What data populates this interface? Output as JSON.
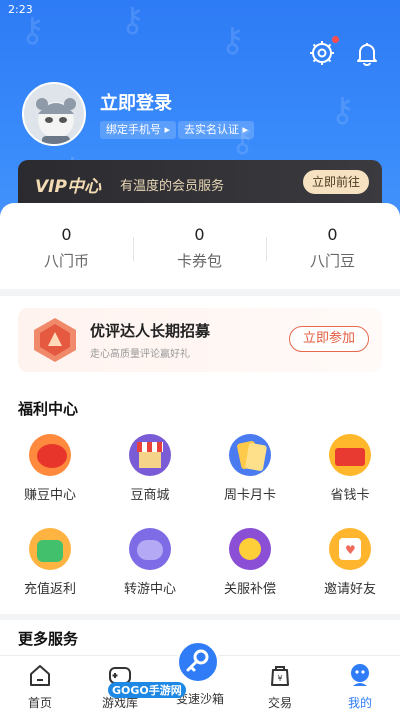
{
  "status_bar": {
    "time": "2:23"
  },
  "header": {
    "login_title": "立即登录",
    "bind_phone": "绑定手机号 ▸",
    "verify": "去实名认证 ▸"
  },
  "vip": {
    "logo": "VIP中心",
    "subtitle": "有温度的会员服务",
    "button": "立即前往"
  },
  "stats": [
    {
      "value": "0",
      "label": "八门币"
    },
    {
      "value": "0",
      "label": "卡券包"
    },
    {
      "value": "0",
      "label": "八门豆"
    }
  ],
  "recruit": {
    "title": "优评达人长期招募",
    "subtitle": "走心高质量评论赢好礼",
    "button": "立即参加"
  },
  "welfare": {
    "title": "福利中心",
    "items": [
      {
        "label": "赚豆中心",
        "icon": "earn-beans-icon"
      },
      {
        "label": "豆商城",
        "icon": "bean-mall-icon"
      },
      {
        "label": "周卡月卡",
        "icon": "week-month-card-icon"
      },
      {
        "label": "省钱卡",
        "icon": "save-money-card-icon"
      },
      {
        "label": "充值返利",
        "icon": "recharge-rebate-icon"
      },
      {
        "label": "转游中心",
        "icon": "transfer-game-icon"
      },
      {
        "label": "关服补偿",
        "icon": "server-compensation-icon"
      },
      {
        "label": "邀请好友",
        "icon": "invite-friends-icon"
      }
    ]
  },
  "more": {
    "title": "更多服务"
  },
  "tabbar": [
    {
      "label": "首页",
      "icon": "home-icon"
    },
    {
      "label": "游戏库",
      "icon": "game-library-icon"
    },
    {
      "label": "变速沙箱",
      "icon": "speed-sandbox-icon"
    },
    {
      "label": "交易",
      "icon": "trade-icon"
    },
    {
      "label": "我的",
      "icon": "profile-icon"
    }
  ],
  "watermark": "GOGO手游网",
  "colors": {
    "primary": "#2f7cf6",
    "vip_gold": "#f3dcb3",
    "accent_red": "#e35b3e"
  }
}
